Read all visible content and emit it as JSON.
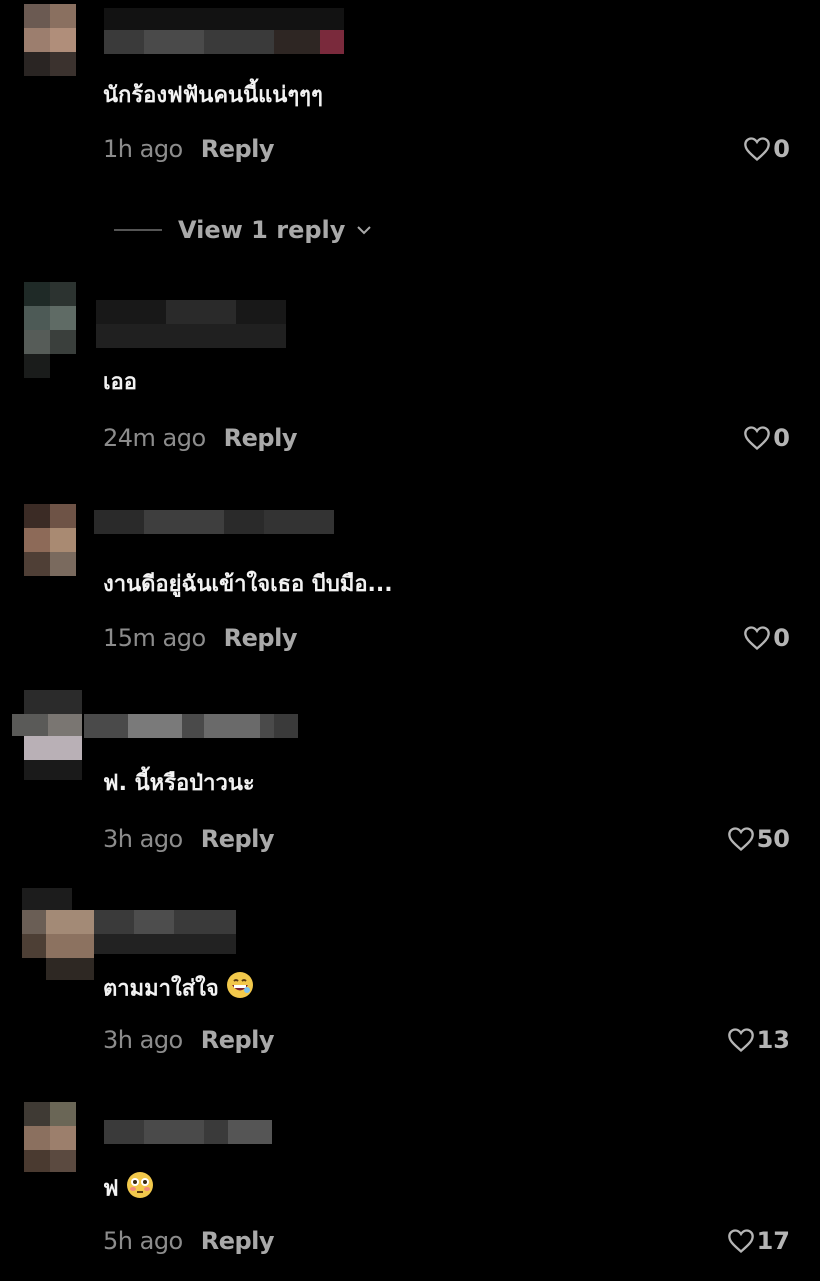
{
  "view_replies_label": "View 1 reply",
  "comments": [
    {
      "text": "นักร้องฟฟันคนนี้แน่ๆๆๆ",
      "time": "1h ago",
      "reply": "Reply",
      "likes": "0"
    },
    {
      "text": "เออ",
      "time": "24m ago",
      "reply": "Reply",
      "likes": "0"
    },
    {
      "text": "งานดีอยู่ฉันเข้าใจเธอ บีบมือ...",
      "time": "15m ago",
      "reply": "Reply",
      "likes": "0"
    },
    {
      "text": "ฟ. นี้หรือป่าวนะ",
      "time": "3h ago",
      "reply": "Reply",
      "likes": "50"
    },
    {
      "text": "ตามมาใส่ใจ",
      "time": "3h ago",
      "reply": "Reply",
      "likes": "13"
    },
    {
      "text": "ฟ",
      "time": "5h ago",
      "reply": "Reply",
      "likes": "17"
    }
  ],
  "icons": {
    "like": "heart-outline-icon",
    "chevron": "chevron-down-icon"
  },
  "colors": {
    "background": "#000000",
    "text": "#f2f2f2",
    "meta": "#8c8c8c"
  }
}
